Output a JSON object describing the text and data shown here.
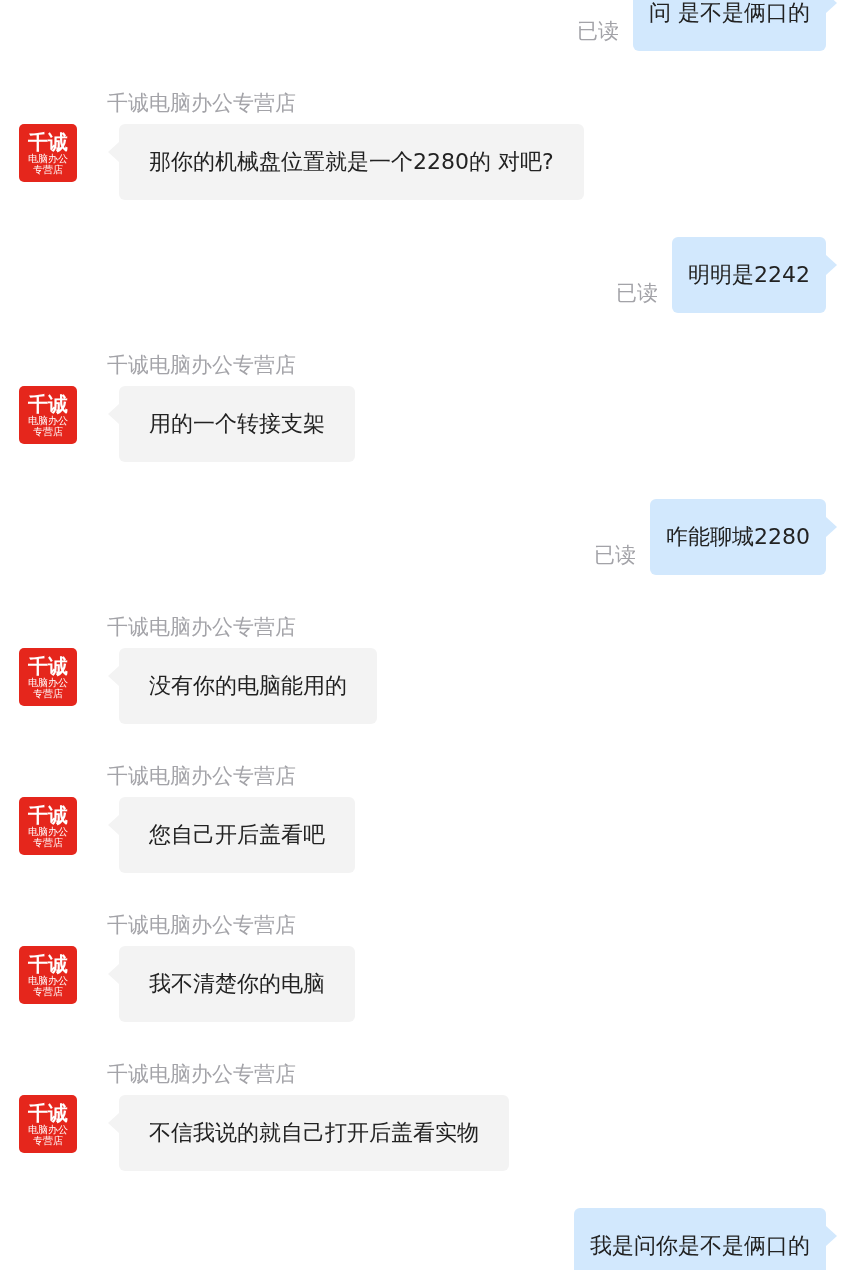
{
  "messages": [
    {
      "kind": "outgoing",
      "text": "问 是不是俩口的",
      "status": "已读"
    },
    {
      "kind": "incoming",
      "sender": "千诚电脑办公专营店",
      "avatar": {
        "title": "千诚",
        "subtitle": "电脑办公专营店"
      },
      "text": "那你的机械盘位置就是一个2280的 对吧?"
    },
    {
      "kind": "outgoing",
      "text": "明明是2242",
      "status": "已读"
    },
    {
      "kind": "incoming",
      "sender": "千诚电脑办公专营店",
      "avatar": {
        "title": "千诚",
        "subtitle": "电脑办公专营店"
      },
      "text": "用的一个转接支架"
    },
    {
      "kind": "outgoing",
      "text": "咋能聊城2280",
      "status": "已读"
    },
    {
      "kind": "incoming",
      "sender": "千诚电脑办公专营店",
      "avatar": {
        "title": "千诚",
        "subtitle": "电脑办公专营店"
      },
      "text": "没有你的电脑能用的"
    },
    {
      "kind": "incoming",
      "sender": "千诚电脑办公专营店",
      "avatar": {
        "title": "千诚",
        "subtitle": "电脑办公专营店"
      },
      "text": "您自己开后盖看吧"
    },
    {
      "kind": "incoming",
      "sender": "千诚电脑办公专营店",
      "avatar": {
        "title": "千诚",
        "subtitle": "电脑办公专营店"
      },
      "text": "我不清楚你的电脑"
    },
    {
      "kind": "incoming",
      "sender": "千诚电脑办公专营店",
      "avatar": {
        "title": "千诚",
        "subtitle": "电脑办公专营店"
      },
      "text": "不信我说的就自己打开后盖看实物"
    },
    {
      "kind": "outgoing",
      "text": "我是问你是不是俩口的"
    }
  ]
}
